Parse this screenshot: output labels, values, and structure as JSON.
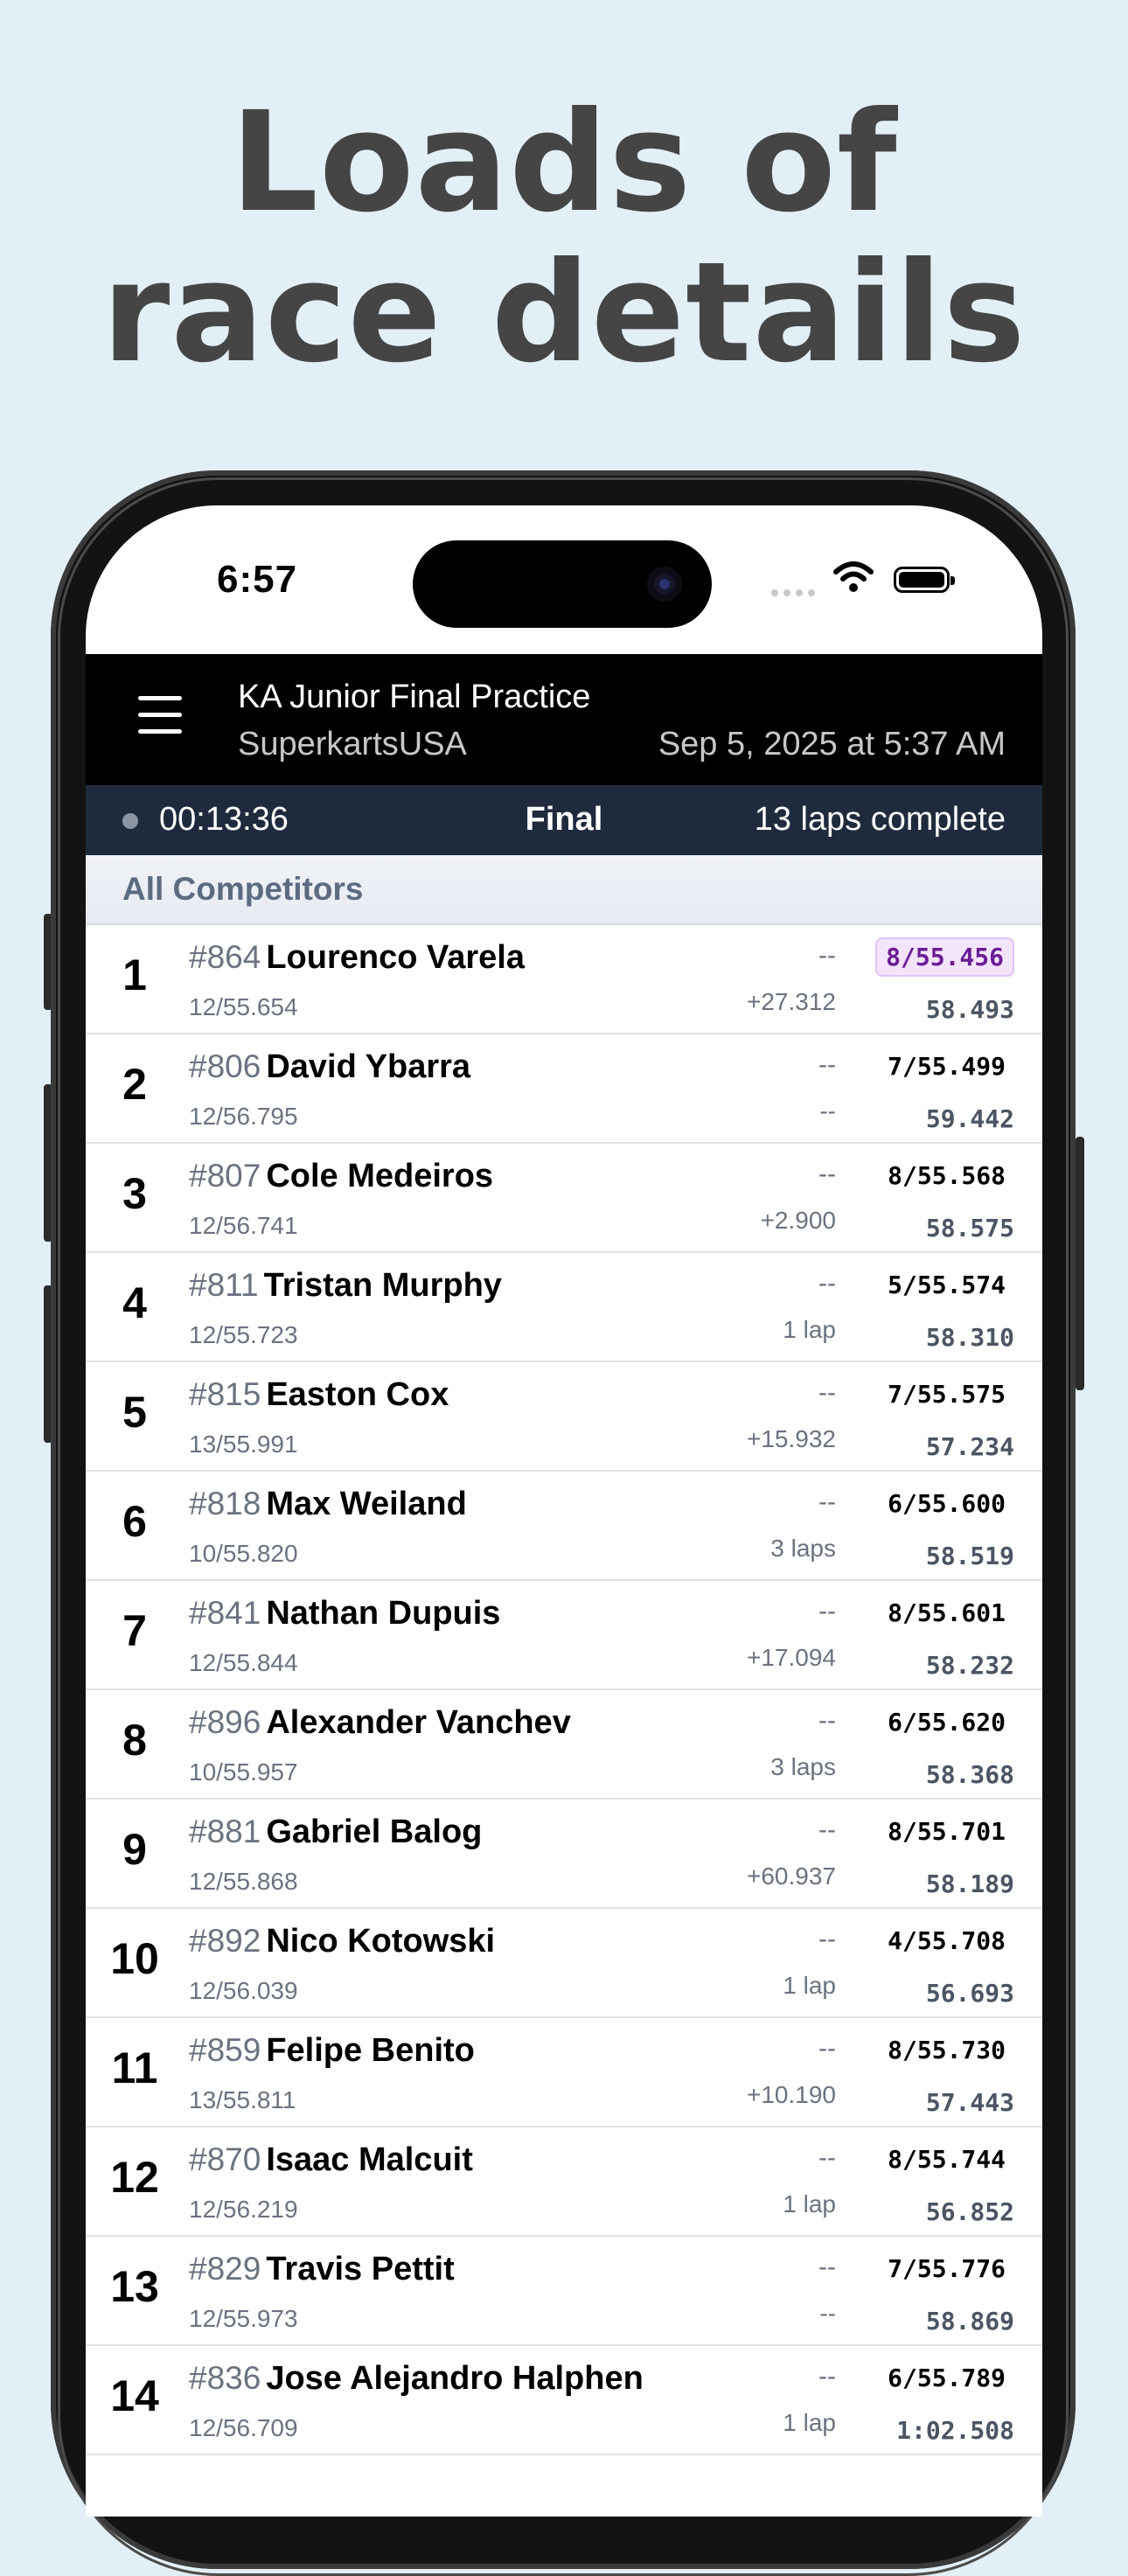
{
  "headline": {
    "line1": "Loads of",
    "line2": "race details"
  },
  "status_bar": {
    "time": "6:57"
  },
  "header": {
    "title": "KA Junior Final Practice",
    "subtitle": "SuperkartsUSA",
    "date": "Sep 5, 2025 at 5:37 AM"
  },
  "race": {
    "elapsed": "00:13:36",
    "status": "Final",
    "laps": "13 laps complete"
  },
  "section": {
    "title": "All Competitors"
  },
  "competitors": [
    {
      "pos": "1",
      "number": "#864",
      "name": "Lourenco Varela",
      "best": "12/55.654",
      "gap": "--",
      "interval": "+27.312",
      "fastest": "8/55.456",
      "last": "58.493",
      "overall_best": true
    },
    {
      "pos": "2",
      "number": "#806",
      "name": "David Ybarra",
      "best": "12/56.795",
      "gap": "--",
      "interval": "--",
      "fastest": "7/55.499",
      "last": "59.442"
    },
    {
      "pos": "3",
      "number": "#807",
      "name": "Cole Medeiros",
      "best": "12/56.741",
      "gap": "--",
      "interval": "+2.900",
      "fastest": "8/55.568",
      "last": "58.575"
    },
    {
      "pos": "4",
      "number": "#811",
      "name": "Tristan Murphy",
      "best": "12/55.723",
      "gap": "--",
      "interval": "1 lap",
      "fastest": "5/55.574",
      "last": "58.310"
    },
    {
      "pos": "5",
      "number": "#815",
      "name": "Easton Cox",
      "best": "13/55.991",
      "gap": "--",
      "interval": "+15.932",
      "fastest": "7/55.575",
      "last": "57.234"
    },
    {
      "pos": "6",
      "number": "#818",
      "name": "Max Weiland",
      "best": "10/55.820",
      "gap": "--",
      "interval": "3 laps",
      "fastest": "6/55.600",
      "last": "58.519"
    },
    {
      "pos": "7",
      "number": "#841",
      "name": "Nathan Dupuis",
      "best": "12/55.844",
      "gap": "--",
      "interval": "+17.094",
      "fastest": "8/55.601",
      "last": "58.232"
    },
    {
      "pos": "8",
      "number": "#896",
      "name": "Alexander Vanchev",
      "best": "10/55.957",
      "gap": "--",
      "interval": "3 laps",
      "fastest": "6/55.620",
      "last": "58.368"
    },
    {
      "pos": "9",
      "number": "#881",
      "name": "Gabriel Balog",
      "best": "12/55.868",
      "gap": "--",
      "interval": "+60.937",
      "fastest": "8/55.701",
      "last": "58.189"
    },
    {
      "pos": "10",
      "number": "#892",
      "name": "Nico Kotowski",
      "best": "12/56.039",
      "gap": "--",
      "interval": "1 lap",
      "fastest": "4/55.708",
      "last": "56.693"
    },
    {
      "pos": "11",
      "number": "#859",
      "name": "Felipe Benito",
      "best": "13/55.811",
      "gap": "--",
      "interval": "+10.190",
      "fastest": "8/55.730",
      "last": "57.443"
    },
    {
      "pos": "12",
      "number": "#870",
      "name": "Isaac Malcuit",
      "best": "12/56.219",
      "gap": "--",
      "interval": "1 lap",
      "fastest": "8/55.744",
      "last": "56.852"
    },
    {
      "pos": "13",
      "number": "#829",
      "name": "Travis Pettit",
      "best": "12/55.973",
      "gap": "--",
      "interval": "--",
      "fastest": "7/55.776",
      "last": "58.869"
    },
    {
      "pos": "14",
      "number": "#836",
      "name": "Jose Alejandro Halphen",
      "best": "12/56.709",
      "gap": "--",
      "interval": "1 lap",
      "fastest": "6/55.789",
      "last": "1:02.508"
    }
  ],
  "icons": {
    "menu": "hamburger-menu-icon",
    "wifi": "wifi-icon",
    "battery": "battery-icon",
    "signal": "cellular-signal-icon",
    "race_indicator": "status-dot-icon"
  },
  "colors": {
    "background": "#e3eff7",
    "header": "#000000",
    "race_bar": "#1f2b3d",
    "overall_best_bg": "#f3e3fb",
    "overall_best_text": "#6a1d96"
  }
}
